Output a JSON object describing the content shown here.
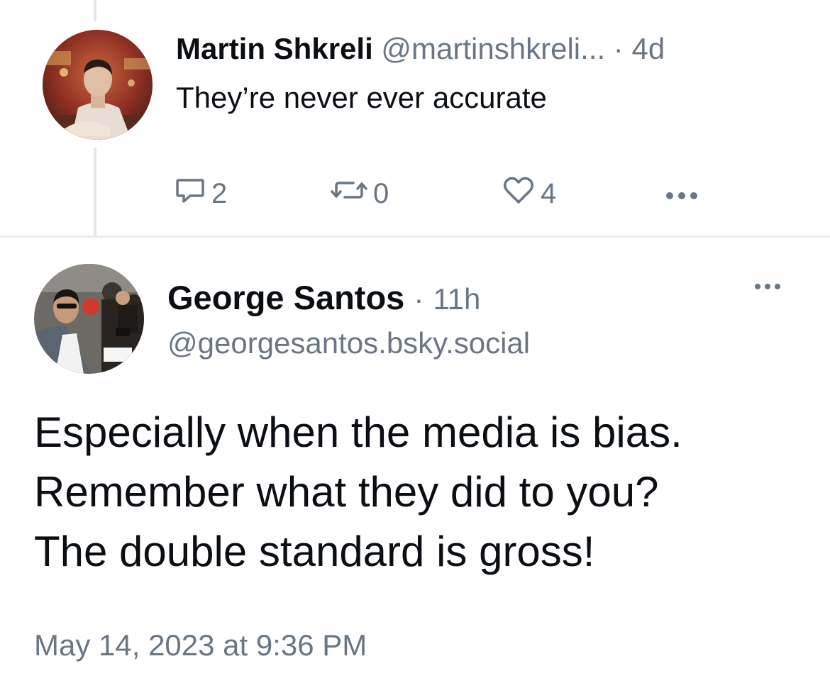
{
  "reply": {
    "author_name": "Martin Shkreli",
    "author_handle": "@martinshkreli...",
    "separator": "·",
    "time_ago": "4d",
    "text": "They’re never ever accurate",
    "reply_count": "2",
    "repost_count": "0",
    "like_count": "4",
    "icons": [
      "reply-icon",
      "repost-icon",
      "like-icon",
      "more-icon"
    ]
  },
  "post": {
    "author_name": "George Santos",
    "separator": "·",
    "time_ago": "11h",
    "author_handle": "@georgesantos.bsky.social",
    "body_lines": [
      "Especially when the media is bias.",
      "Remember what they did to you?",
      "The double standard is gross!"
    ],
    "timestamp": "May 14, 2023 at 9:36 PM"
  },
  "colors": {
    "text_primary": "#0b0f14",
    "text_secondary": "#6b7684",
    "thread_line": "#e3e6ea",
    "divider": "#e8eaed"
  }
}
